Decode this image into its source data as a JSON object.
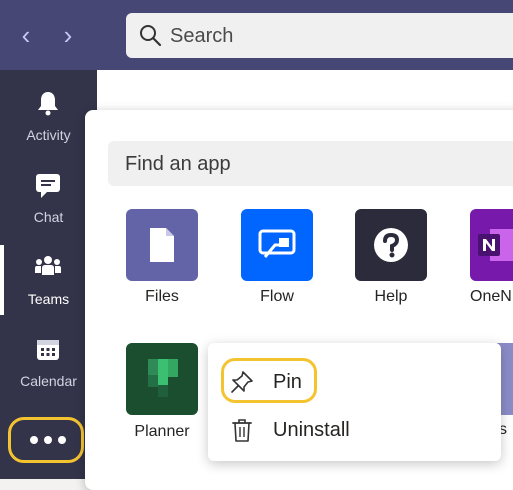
{
  "topbar": {
    "back_glyph": "‹",
    "forward_glyph": "›",
    "search_placeholder": "Search"
  },
  "rail": {
    "items": [
      {
        "label": "Activity",
        "icon": "bell-icon"
      },
      {
        "label": "Chat",
        "icon": "chat-icon"
      },
      {
        "label": "Teams",
        "icon": "teams-icon"
      },
      {
        "label": "Calendar",
        "icon": "calendar-icon"
      }
    ],
    "active": "Teams",
    "more_icon": "more-dots-icon"
  },
  "panel": {
    "find_placeholder": "Find an app",
    "apps": [
      {
        "label": "Files",
        "color": "#6264a7"
      },
      {
        "label": "Flow",
        "color": "#0066ff"
      },
      {
        "label": "Help",
        "color": "#2b2b3b"
      },
      {
        "label": "OneN",
        "color": "#7719aa"
      },
      {
        "label": "Planner",
        "color": "#1b4d2f"
      }
    ],
    "partial_label": "s"
  },
  "context_menu": {
    "pin_label": "Pin",
    "uninstall_label": "Uninstall"
  },
  "colors": {
    "topbar": "#464775",
    "rail": "#33344a",
    "highlight": "#f4c430"
  }
}
